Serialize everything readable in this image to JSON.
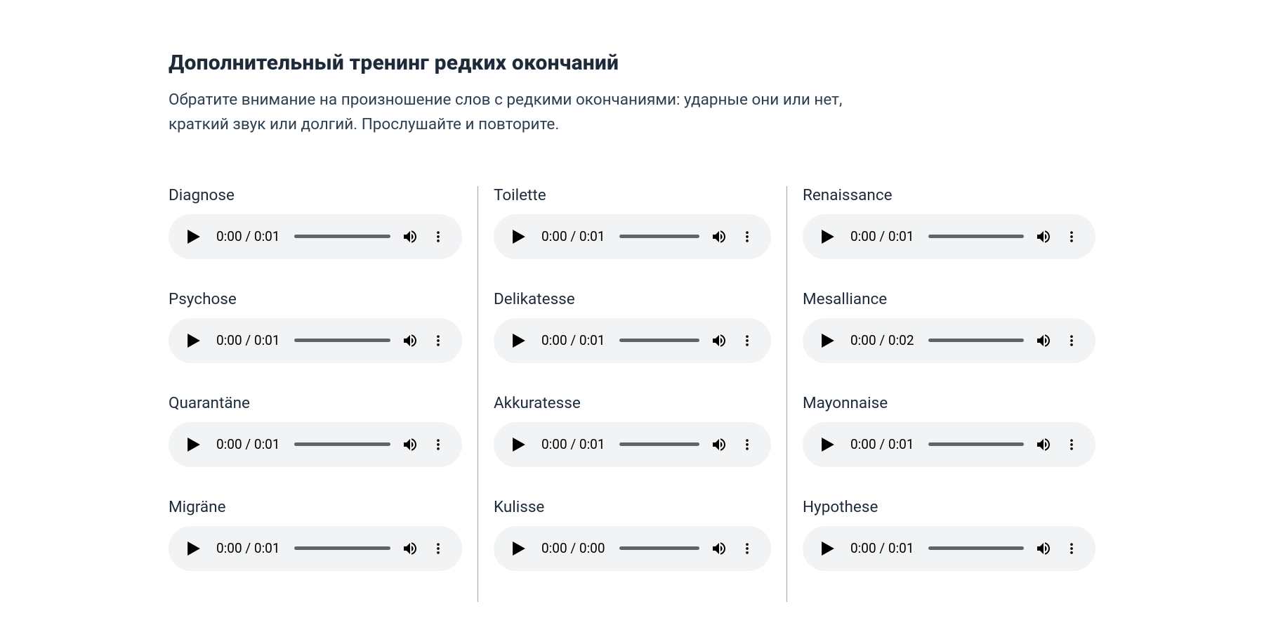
{
  "section": {
    "title": "Дополнительный тренинг редких окончаний",
    "description": "Обратите внимание на произношение слов с редкими окончаниями: ударные они или нет, краткий звук или долгий. Прослушайте и повторите."
  },
  "columns": [
    [
      {
        "word": "Diagnose",
        "time": "0:00 / 0:01"
      },
      {
        "word": "Psychose",
        "time": "0:00 / 0:01"
      },
      {
        "word": "Quarantäne",
        "time": "0:00 / 0:01"
      },
      {
        "word": "Migräne",
        "time": "0:00 / 0:01"
      }
    ],
    [
      {
        "word": "Toilette",
        "time": "0:00 / 0:01"
      },
      {
        "word": "Delikatesse",
        "time": "0:00 / 0:01"
      },
      {
        "word": "Akkuratesse",
        "time": "0:00 / 0:01"
      },
      {
        "word": "Kulisse",
        "time": "0:00 / 0:00"
      }
    ],
    [
      {
        "word": "Renaissance",
        "time": "0:00 / 0:01"
      },
      {
        "word": "Mesalliance",
        "time": "0:00 / 0:02"
      },
      {
        "word": "Mayonnaise",
        "time": "0:00 / 0:01"
      },
      {
        "word": "Hypothese",
        "time": "0:00 / 0:01"
      }
    ]
  ]
}
